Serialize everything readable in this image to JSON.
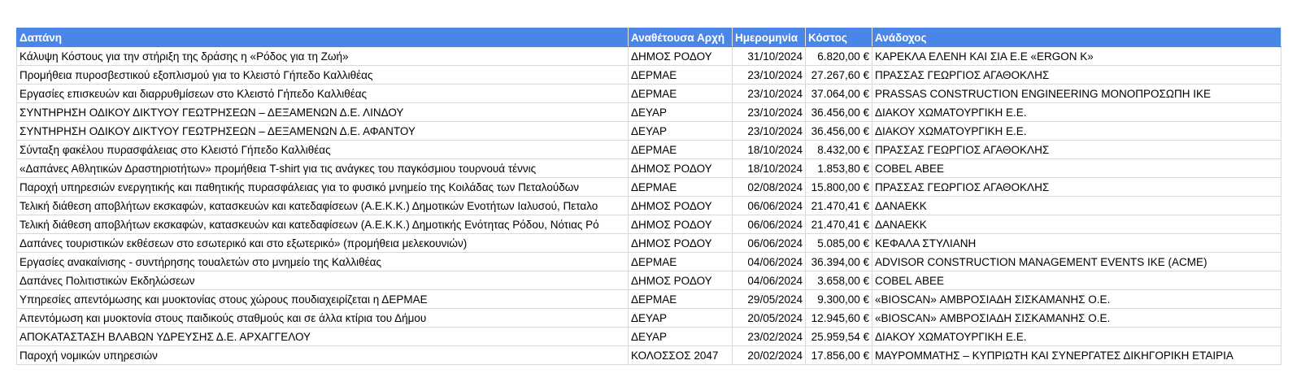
{
  "table": {
    "headers": [
      "Δαπάνη",
      "Αναθέτουσα Αρχή",
      "Ημερομηνία",
      "Κόστος",
      "Ανάδοχος"
    ],
    "rows": [
      [
        "Κάλυψη Κόστους για την στήριξη της δράσης η «Ρόδος για τη Ζωή»",
        "ΔΗΜΟΣ ΡΟΔΟΥ",
        "31/10/2024",
        "6.820,00 €",
        "ΚΑΡΕΚΛΑ ΕΛΕΝΗ ΚΑΙ ΣΙΑ Ε.Ε «ERGON K»"
      ],
      [
        "Προμήθεια πυροσβεστικού εξοπλισμού για το Κλειστό Γήπεδο Καλλιθέας",
        "ΔΕΡΜΑΕ",
        "23/10/2024",
        "27.267,60 €",
        "ΠΡΑΣΣΑΣ ΓΕΩΡΓΙΟΣ ΑΓΑΘΟΚΛΗΣ"
      ],
      [
        "Εργασίες επισκευών και διαρρυθμίσεων στο Κλειστό Γήπεδο Καλλιθέας",
        "ΔΕΡΜΑΕ",
        "23/10/2024",
        "37.064,00 €",
        "PRASSAS CONSTRUCTION ENGINEERING ΜΟΝΟΠΡΟΣΩΠΗ ΙΚΕ"
      ],
      [
        "ΣΥΝΤΗΡΗΣΗ ΟΔΙΚΟΥ ΔΙΚΤΥΟΥ ΓΕΩΤΡΗΣΕΩΝ – ΔΕΞΑΜΕΝΩΝ Δ.Ε. ΛΙΝΔΟΥ",
        "ΔΕΥΑΡ",
        "23/10/2024",
        "36.456,00 €",
        "ΔΙΑΚΟΥ ΧΩΜΑΤΟΥΡΓΙΚΗ Ε.Ε."
      ],
      [
        "ΣΥΝΤΗΡΗΣΗ ΟΔΙΚΟΥ ΔΙΚΤΥΟΥ ΓΕΩΤΡΗΣΕΩΝ – ΔΕΞΑΜΕΝΩΝ Δ.Ε. ΑΦΑΝΤΟΥ",
        "ΔΕΥΑΡ",
        "23/10/2024",
        "36.456,00 €",
        "ΔΙΑΚΟΥ ΧΩΜΑΤΟΥΡΓΙΚΗ Ε.Ε."
      ],
      [
        "Σύνταξη φακέλου πυρασφάλειας στο Κλειστό Γήπεδο Καλλιθέας",
        "ΔΕΡΜΑΕ",
        "18/10/2024",
        "8.432,00 €",
        "ΠΡΑΣΣΑΣ ΓΕΩΡΓΙΟΣ ΑΓΑΘΟΚΛΗΣ"
      ],
      [
        "«Δαπάνες Αθλητικών Δραστηριοτήτων» προμήθεια T-shirt για τις ανάγκες του παγκόσμιου τουρνουά τέννις",
        "ΔΗΜΟΣ ΡΟΔΟΥ",
        "18/10/2024",
        "1.853,80 €",
        "COBEL ΑΒΕΕ"
      ],
      [
        "Παροχή υπηρεσιών ενεργητικής και παθητικής πυρασφάλειας για το φυσικό μνημείο της Κοιλάδας των Πεταλούδων",
        "ΔΕΡΜΑΕ",
        "02/08/2024",
        "15.800,00 €",
        "ΠΡΑΣΣΑΣ ΓΕΩΡΓΙΟΣ ΑΓΑΘΟΚΛΗΣ"
      ],
      [
        "Τελική διάθεση αποβλήτων εκσκαφών, κατασκευών και κατεδαφίσεων (Α.Ε.Κ.Κ.) Δημοτικών Ενοτήτων Ιαλυσού, Πεταλο",
        "ΔΗΜΟΣ ΡΟΔΟΥ",
        "06/06/2024",
        "21.470,41 €",
        "ΔΑΝΑΕΚΚ"
      ],
      [
        "Τελική διάθεση αποβλήτων εκσκαφών, κατασκευών και κατεδαφίσεων (Α.Ε.Κ.Κ.) Δημοτικής Ενότητας Ρόδου, Νότιας Ρό",
        "ΔΗΜΟΣ ΡΟΔΟΥ",
        "06/06/2024",
        "21.470,41 €",
        "ΔΑΝΑΕΚΚ"
      ],
      [
        "Δαπάνες τουριστικών εκθέσεων στο εσωτερικό και στο εξωτερικό» (προμήθεια μελεκουνιών)",
        "ΔΗΜΟΣ ΡΟΔΟΥ",
        "06/06/2024",
        "5.085,00 €",
        "ΚΕΦΑΛΑ ΣΤΥΛΙΑΝΗ"
      ],
      [
        "Εργασίες ανακαίνισης - συντήρησης τουαλετών στο μνημείο της Καλλιθέας",
        "ΔΕΡΜΑΕ",
        "04/06/2024",
        "36.394,00 €",
        "ADVISOR CONSTRUCTION MANAGEMENT EVENTS IKE (ACME)"
      ],
      [
        "Δαπάνες Πολιτιστικών Εκδηλώσεων",
        "ΔΗΜΟΣ ΡΟΔΟΥ",
        "04/06/2024",
        "3.658,00 €",
        "COBEL ΑΒΕΕ"
      ],
      [
        "Υπηρεσίες απεντόμωσης και μυοκτονίας στους χώρους πουδιαχειρίζεται η ΔΕΡΜΑΕ",
        "ΔΕΡΜΑΕ",
        "29/05/2024",
        "9.300,00 €",
        "«BIOSCAN» ΑΜΒΡΟΣΙΑΔΗ ΣΙΣΚΑΜΑΝΗΣ Ο.Ε."
      ],
      [
        "Απεντόμωση και μυοκτονία στους παιδικούς σταθμούς και σε άλλα κτίρια του Δήμου",
        "ΔΕΥΑΡ",
        "20/05/2024",
        "12.945,60 €",
        "«BIOSCAN» ΑΜΒΡΟΣΙΑΔΗ ΣΙΣΚΑΜΑΝΗΣ Ο.Ε."
      ],
      [
        "ΑΠΟΚΑΤΑΣΤΑΣΗ ΒΛΑΒΩΝ ΥΔΡΕΥΣΗΣ Δ.Ε. ΑΡΧΑΓΓΕΛΟΥ",
        "ΔΕΥΑΡ",
        "23/02/2024",
        "25.959,54 €",
        "ΔΙΑΚΟΥ ΧΩΜΑΤΟΥΡΓΙΚΗ Ε.Ε."
      ],
      [
        "Παροχή νομικών υπηρεσιών",
        "ΚΟΛΟΣΣΟΣ 2047",
        "20/02/2024",
        "17.856,00 €",
        "ΜΑΥΡΟΜΜΑΤΗΣ – ΚΥΠΡΙΩΤΗ ΚΑΙ ΣΥΝΕΡΓΑΤΕΣ ΔΙΚΗΓΟΡΙΚΗ ΕΤΑΙΡΙΑ"
      ]
    ]
  },
  "colors": {
    "header_background": "#4a86e8",
    "header_text": "#ffffff",
    "grid_line": "#d9d9d9"
  }
}
